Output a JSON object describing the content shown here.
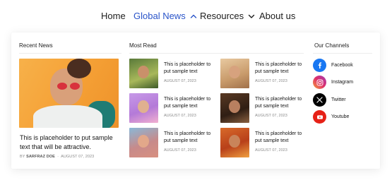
{
  "nav": {
    "items": [
      {
        "label": "Home"
      },
      {
        "label": "Global News"
      },
      {
        "label": "Resources"
      },
      {
        "label": "About us"
      }
    ]
  },
  "recent_news": {
    "title": "Recent News",
    "headline": "This is placeholder to put sample text that will be attractive.",
    "author_prefix": "BY",
    "author": "SARFRAZ DOE",
    "separator": "-",
    "date": "AUGUST 07, 2023"
  },
  "most_read": {
    "title": "Most Read",
    "items": [
      {
        "text": "This is placeholder to put sample text",
        "date": "AUGUST 07, 2023"
      },
      {
        "text": "This is placeholder to put sample text",
        "date": "AUGUST 07, 2023"
      },
      {
        "text": "This is placeholder to put sample text",
        "date": "AUGUST 07, 2023"
      },
      {
        "text": "This is placeholder to put sample text",
        "date": "AUGUST 07, 2023"
      },
      {
        "text": "This is placeholder to put sample text",
        "date": "AUGUST 07, 2023"
      },
      {
        "text": "This is placeholder to put sample text",
        "date": "AUGUST 07, 2023"
      }
    ]
  },
  "channels": {
    "title": "Our Channels",
    "items": [
      {
        "label": "Facebook",
        "icon": "facebook-icon",
        "color": "#1877f2"
      },
      {
        "label": "Instagram",
        "icon": "instagram-icon",
        "color": "#d6336c"
      },
      {
        "label": "Twitter",
        "icon": "x-twitter-icon",
        "color": "#000000"
      },
      {
        "label": "Youtube",
        "icon": "youtube-icon",
        "color": "#e62117"
      }
    ]
  },
  "colors": {
    "accent": "#2a54c9",
    "text": "#141414",
    "muted": "#8a8a8a"
  }
}
